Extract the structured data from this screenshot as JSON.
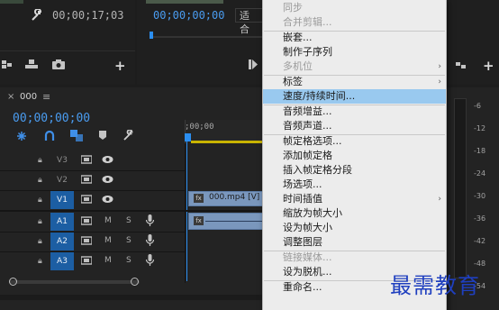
{
  "source_monitor": {
    "wrench_icon": "wrench-icon",
    "timecode": "00;00;17;03",
    "controls": [
      "insert-clip-icon",
      "export-icon",
      "camera-icon",
      "plus-icon"
    ]
  },
  "program_monitor": {
    "timecode": "00;00;00;00",
    "fit_label": "适合",
    "controls": [
      "step-icon",
      "plus-icon"
    ]
  },
  "timeline": {
    "close_glyph": "×",
    "sequence_name": "000",
    "menu_glyph": "≡",
    "timecode": "00;00;00;00",
    "ruler_start": ";00;00",
    "tools": [
      "snap-icon",
      "magnet-icon",
      "linked-selection-icon",
      "marker-icon",
      "wrench-icon"
    ],
    "tracks": [
      {
        "id": "V3",
        "targeted": false,
        "kind": "video"
      },
      {
        "id": "V2",
        "targeted": false,
        "kind": "video"
      },
      {
        "id": "V1",
        "targeted": true,
        "kind": "video"
      },
      {
        "id": "A1",
        "targeted": true,
        "kind": "audio"
      },
      {
        "id": "A2",
        "targeted": true,
        "kind": "audio"
      },
      {
        "id": "A3",
        "targeted": true,
        "kind": "audio"
      }
    ],
    "audio_buttons": {
      "mute": "M",
      "solo": "S"
    },
    "video_clip_label": "000.mp4 [V]",
    "fx_badge": "fx"
  },
  "meter": {
    "scale": [
      "-6",
      "-12",
      "-18",
      "-24",
      "-30",
      "-36",
      "-42",
      "-48",
      "-54"
    ]
  },
  "context_menu": {
    "items": [
      {
        "label": "同步",
        "disabled": true
      },
      {
        "label": "合并剪辑...",
        "disabled": true
      },
      {
        "label": "嵌套...",
        "disabled": false
      },
      {
        "label": "制作子序列",
        "disabled": false
      },
      {
        "label": "多机位",
        "disabled": true,
        "submenu": true
      },
      {
        "label": "标签",
        "disabled": false,
        "submenu": true
      },
      {
        "label": "速度/持续时间...",
        "disabled": false,
        "highlighted": true
      },
      {
        "label": "音频增益...",
        "disabled": false
      },
      {
        "label": "音频声道...",
        "disabled": false
      },
      {
        "label": "帧定格选项...",
        "disabled": false
      },
      {
        "label": "添加帧定格",
        "disabled": false
      },
      {
        "label": "插入帧定格分段",
        "disabled": false
      },
      {
        "label": "场选项...",
        "disabled": false
      },
      {
        "label": "时间插值",
        "disabled": false,
        "submenu": true
      },
      {
        "label": "缩放为帧大小",
        "disabled": false
      },
      {
        "label": "设为帧大小",
        "disabled": false
      },
      {
        "label": "调整图层",
        "disabled": false
      },
      {
        "label": "链接媒体...",
        "disabled": true
      },
      {
        "label": "设为脱机...",
        "disabled": false
      },
      {
        "label": "重命名...",
        "disabled": false
      }
    ]
  },
  "watermark": {
    "text": "最需教育",
    "color": "#1f3fbf"
  },
  "colors": {
    "accent_blue": "#4a9cf0",
    "target_blue": "#1c5ea3",
    "playhead_blue": "#2b8ef0",
    "menu_highlight": "#99c9ef"
  }
}
